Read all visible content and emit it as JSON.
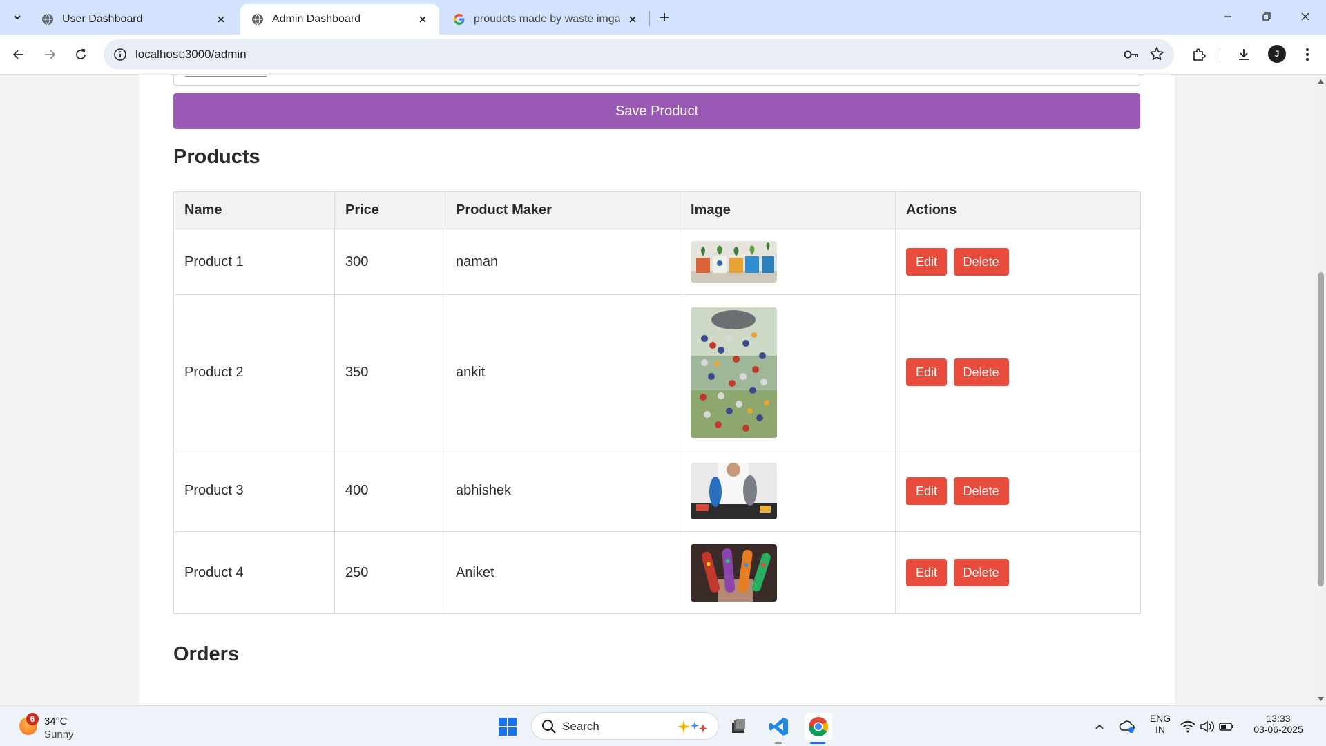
{
  "browser": {
    "tabs": [
      {
        "title": "User Dashboard",
        "active": false
      },
      {
        "title": "Admin Dashboard",
        "active": true
      },
      {
        "title": "proudcts made by waste imgae",
        "active": false
      }
    ],
    "url": "localhost:3000/admin",
    "profile_initial": "J"
  },
  "form": {
    "save_label": "Save Product"
  },
  "products_section": {
    "title": "Products",
    "columns": [
      "Name",
      "Price",
      "Product Maker",
      "Image",
      "Actions"
    ],
    "rows": [
      {
        "name": "Product 1",
        "price": "300",
        "maker": "naman",
        "image": "potted-succulents-image",
        "edit": "Edit",
        "delete": "Delete"
      },
      {
        "name": "Product 2",
        "price": "350",
        "maker": "ankit",
        "image": "bottle-cap-wind-chime-image",
        "edit": "Edit",
        "delete": "Delete"
      },
      {
        "name": "Product 3",
        "price": "400",
        "maker": "abhishek",
        "image": "upcycled-slippers-image",
        "edit": "Edit",
        "delete": "Delete"
      },
      {
        "name": "Product 4",
        "price": "250",
        "maker": "Aniket",
        "image": "painted-bottles-image",
        "edit": "Edit",
        "delete": "Delete"
      }
    ]
  },
  "orders_section": {
    "title": "Orders"
  },
  "colors": {
    "save_button": "#9b59b6",
    "action_button": "#e74c3c",
    "tabstrip": "#d3e3fd"
  },
  "taskbar": {
    "weather_badge": "6",
    "temperature": "34°C",
    "condition": "Sunny",
    "search_placeholder": "Search",
    "language": "ENG",
    "region": "IN",
    "time": "13:33",
    "date": "03-06-2025"
  }
}
